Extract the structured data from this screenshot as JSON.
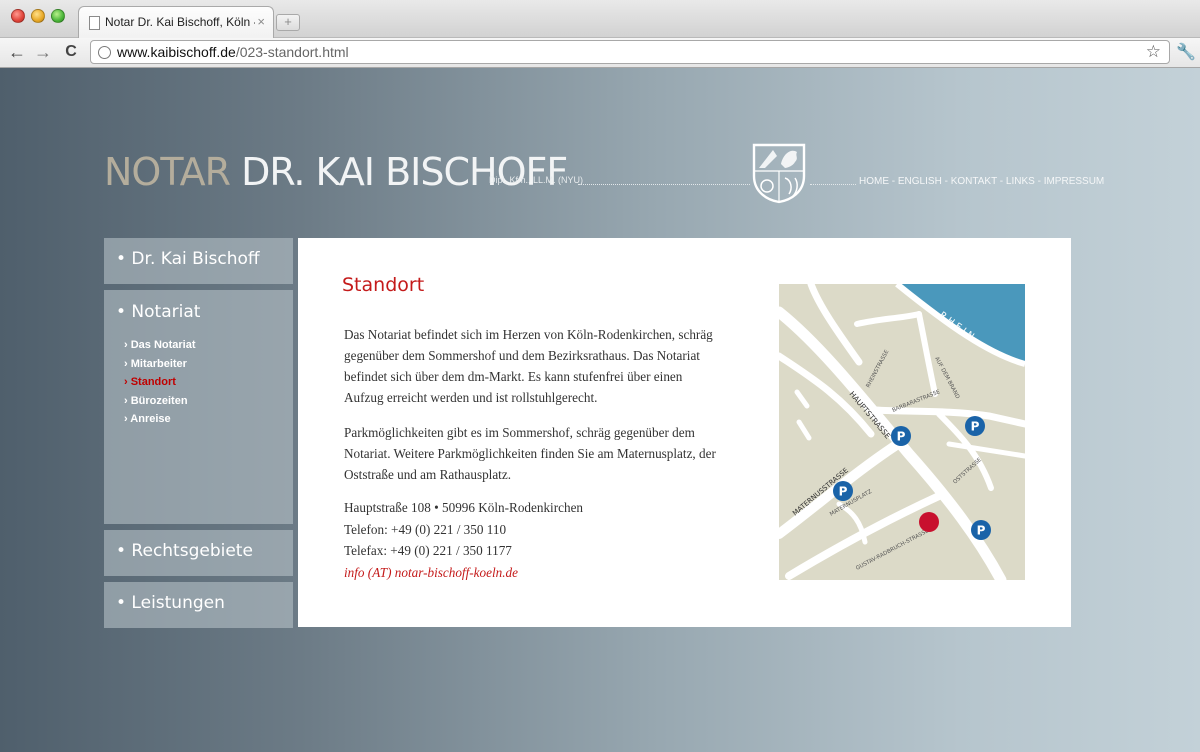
{
  "browser": {
    "tab_title": "Notar Dr. Kai Bischoff, Köln -",
    "tab_close": "×",
    "new_tab": "+",
    "url_host": "www.kaibischoff.de",
    "url_path": "/023-standort.html",
    "back": "←",
    "forward": "→",
    "reload": "C",
    "bookmark": "☆",
    "wrench": "🔧"
  },
  "header": {
    "logo_notar": "NOTAR",
    "logo_name": "DR. KAI BISCHOFF",
    "degree": "Dipl. Kfm., LL.M. (NYU)",
    "nav": [
      "HOME",
      "ENGLISH",
      "KONTAKT",
      "LINKS",
      "IMPRESSUM"
    ],
    "nav_sep": " - "
  },
  "sidebar": {
    "sections": [
      "• Dr. Kai Bischoff",
      "• Notariat",
      "• Rechtsgebiete",
      "• Leistungen"
    ],
    "sub_items": [
      "› Das Notariat",
      "› Mitarbeiter",
      "› Standort",
      "› Bürozeiten",
      "› Anreise"
    ],
    "active_sub": 2
  },
  "content": {
    "title": "Standort",
    "p1_lines": [
      "Das Notariat befindet sich im Herzen von Köln-Rodenkirchen, schräg",
      "gegenüber dem Sommershof und dem Bezirksrathaus. Das Notariat",
      "befindet sich über dem dm-Markt. Es kann stufenfrei über einen",
      "Aufzug erreicht werden und ist rollstuhlgerecht."
    ],
    "p2_lines": [
      "Parkmöglichkeiten gibt es im Sommershof, schräg gegenüber dem",
      "Notariat. Weitere Parkmöglichkeiten finden Sie am Maternusplatz, der",
      "Oststraße und am Rathausplatz."
    ],
    "address": "Hauptstraße 108 •  50996 Köln-Rodenkirchen",
    "phone": "Telefon: +49 (0) 221 / 350 110",
    "fax": "Telefax: +49 (0) 221 / 350 1177",
    "email": "info (AT) notar-bischoff-koeln.de"
  },
  "map": {
    "river": "RHEIN",
    "streets": [
      "RHEINSTRASSE",
      "AUF DEM BRAND",
      "BARBARASTRASSE",
      "HAUPTSTRASSE",
      "MATERNUSSTRASSE",
      "MATERNUSPLATZ",
      "OSTSTRASSE",
      "GUSTAV-RADBRUCH-STRASSE"
    ],
    "parking": "P",
    "colors": {
      "land": "#dcdac8",
      "road": "#ffffff",
      "water": "#4a98bc",
      "parking": "#1a63a8",
      "marker": "#c8102e"
    }
  }
}
